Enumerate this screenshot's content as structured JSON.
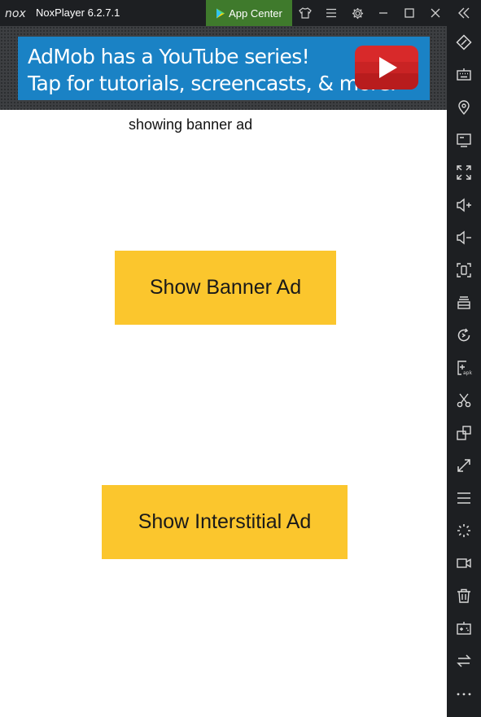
{
  "titlebar": {
    "app_title": "NoxPlayer 6.2.7.1",
    "app_center_label": "App Center",
    "icons": [
      "nox-logo-icon",
      "play-store-icon",
      "tshirt-icon",
      "menu-icon",
      "gear-icon",
      "minimize-icon",
      "maximize-icon",
      "close-icon",
      "collapse-sidebar-icon"
    ]
  },
  "banner_ad": {
    "line1": "AdMob has a YouTube series!",
    "line2": "Tap for tutorials, screencasts, & more.",
    "background_color": "#1a82c5",
    "logo_icon": "youtube-play-icon"
  },
  "main": {
    "status_text": "showing banner ad",
    "banner_button_label": "Show Banner Ad",
    "interstitial_button_label": "Show Interstitial Ad",
    "button_color": "#fbc62d"
  },
  "sidebar": {
    "items": [
      {
        "name": "rotate-screen-icon"
      },
      {
        "name": "keyboard-icon"
      },
      {
        "name": "location-icon"
      },
      {
        "name": "screen-icon"
      },
      {
        "name": "fullscreen-icon"
      },
      {
        "name": "volume-up-icon"
      },
      {
        "name": "volume-down-icon"
      },
      {
        "name": "screenshot-icon"
      },
      {
        "name": "multi-instance-icon"
      },
      {
        "name": "refresh-icon"
      },
      {
        "name": "add-apk-icon"
      },
      {
        "name": "scissors-icon"
      },
      {
        "name": "multi-window-icon"
      },
      {
        "name": "resize-icon"
      },
      {
        "name": "menu-icon"
      },
      {
        "name": "loading-icon"
      },
      {
        "name": "video-record-icon"
      },
      {
        "name": "trash-icon"
      },
      {
        "name": "gamepad-icon"
      },
      {
        "name": "sync-icon"
      },
      {
        "name": "more-icon"
      }
    ]
  }
}
